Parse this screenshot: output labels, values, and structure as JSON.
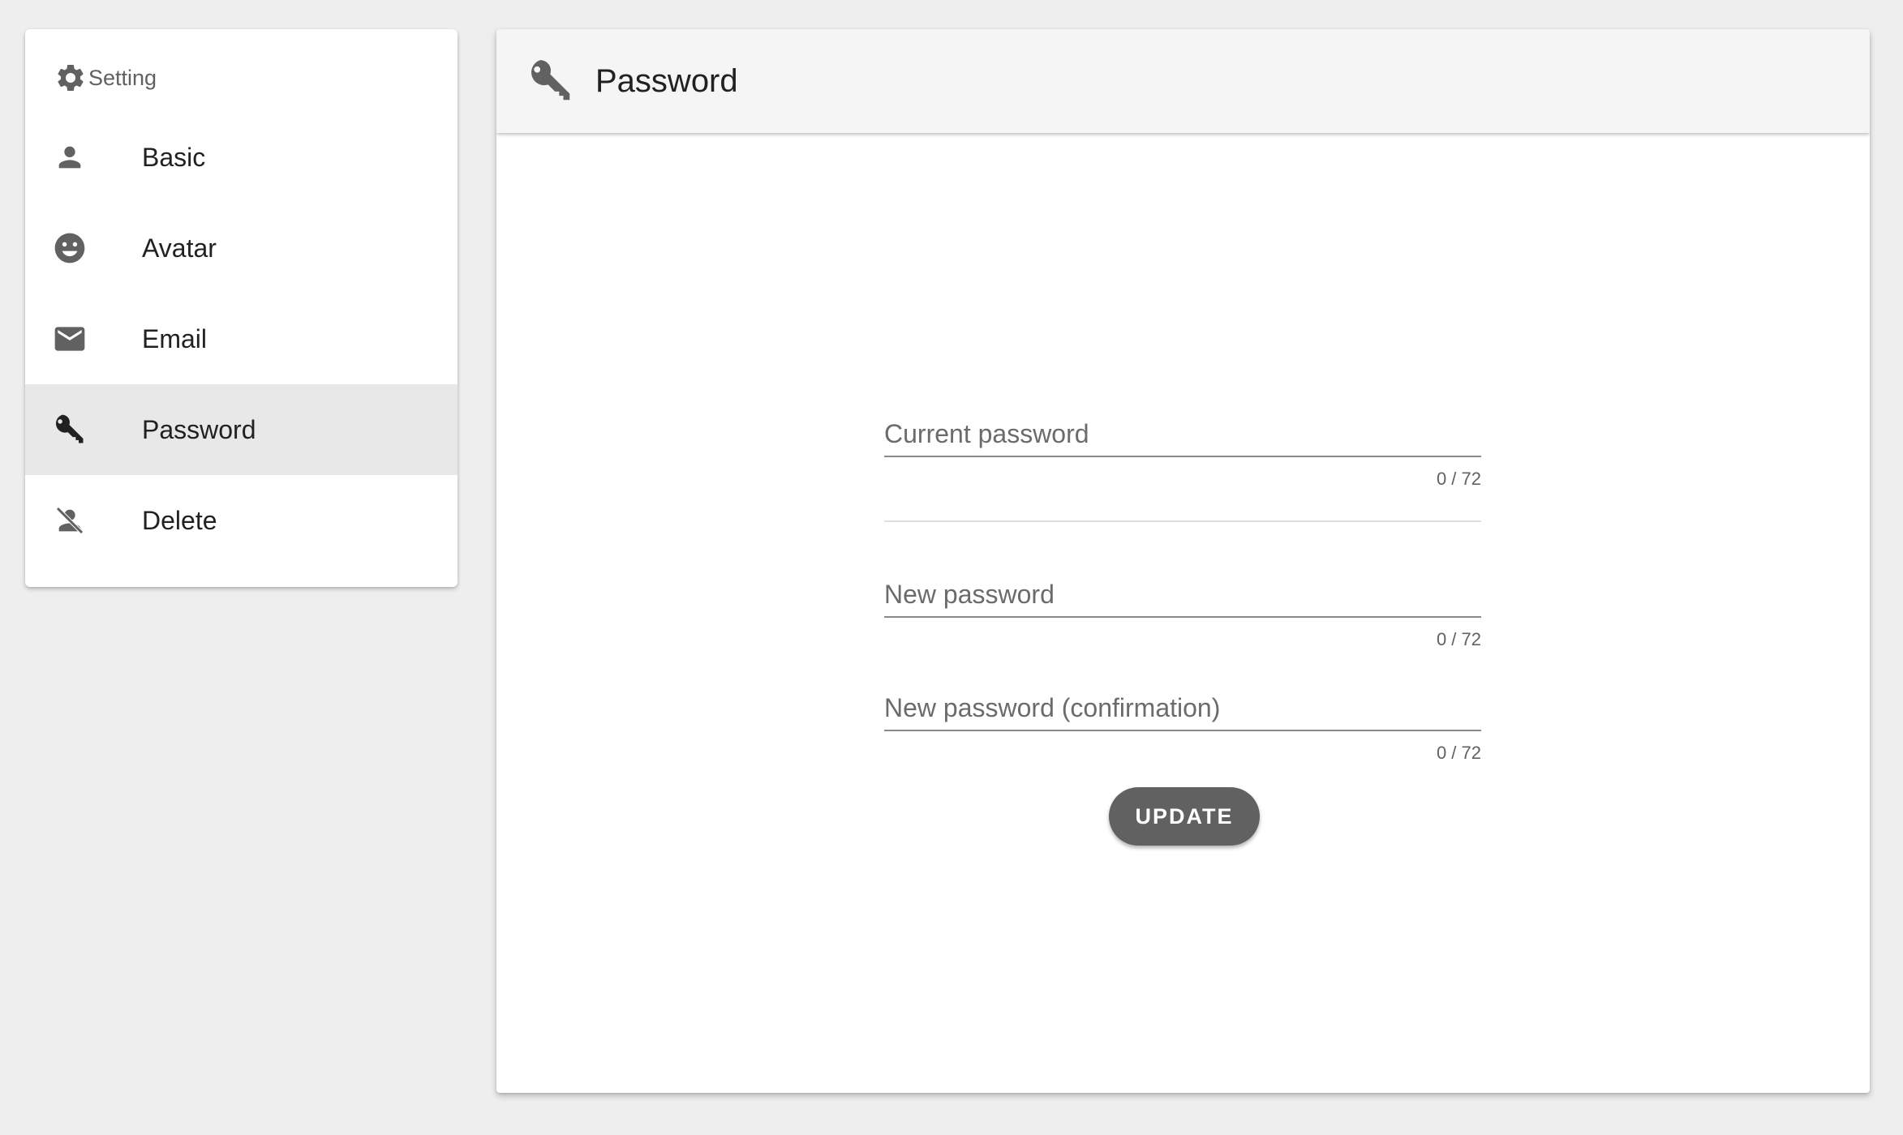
{
  "sidebar": {
    "header": {
      "label": "Setting",
      "icon": "gear-icon"
    },
    "items": [
      {
        "label": "Basic",
        "icon": "person-icon",
        "active": false
      },
      {
        "label": "Avatar",
        "icon": "smiley-icon",
        "active": false
      },
      {
        "label": "Email",
        "icon": "mail-icon",
        "active": false
      },
      {
        "label": "Password",
        "icon": "key-icon",
        "active": true
      },
      {
        "label": "Delete",
        "icon": "person-off-icon",
        "active": false
      }
    ]
  },
  "main": {
    "title": "Password",
    "icon": "key-icon",
    "form": {
      "current_password": {
        "placeholder": "Current password",
        "value": "",
        "counter": "0 / 72"
      },
      "new_password": {
        "placeholder": "New password",
        "value": "",
        "counter": "0 / 72"
      },
      "new_password_confirmation": {
        "placeholder": "New password (confirmation)",
        "value": "",
        "counter": "0 / 72"
      },
      "update_label": "UPDATE"
    }
  },
  "colors": {
    "background": "#eeeeee",
    "active_item": "#e8e8e8",
    "header_bar": "#f5f5f5",
    "button": "#616161",
    "icon_gray": "#616161"
  }
}
